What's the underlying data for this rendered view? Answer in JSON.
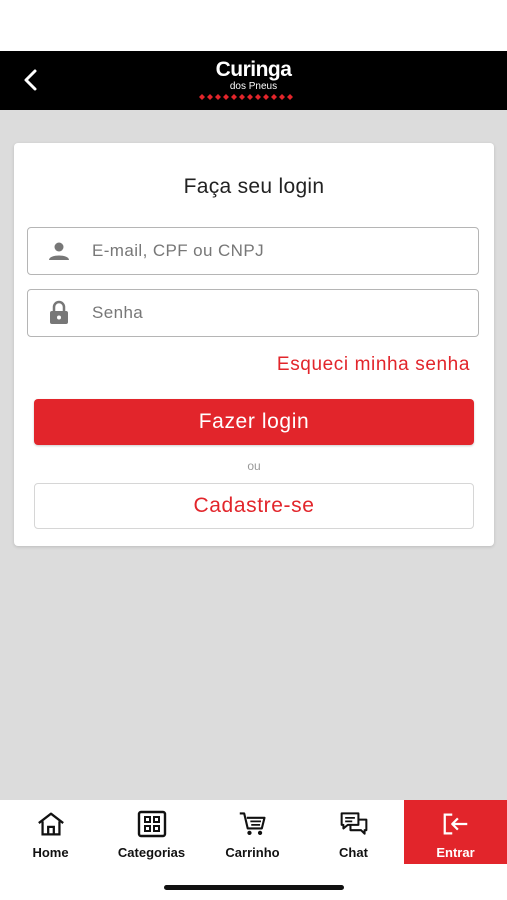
{
  "header": {
    "logo_main": "Curinga",
    "logo_sub": "dos Pneus"
  },
  "login": {
    "title": "Faça seu login",
    "email_placeholder": "E-mail, CPF ou CNPJ",
    "password_placeholder": "Senha",
    "forgot_label": "Esqueci minha senha",
    "login_button": "Fazer login",
    "or_label": "ou",
    "signup_button": "Cadastre-se"
  },
  "tabs": [
    {
      "label": "Home",
      "icon": "home-icon"
    },
    {
      "label": "Categorias",
      "icon": "grid-icon"
    },
    {
      "label": "Carrinho",
      "icon": "cart-icon"
    },
    {
      "label": "Chat",
      "icon": "chat-icon"
    },
    {
      "label": "Entrar",
      "icon": "login-icon"
    }
  ],
  "colors": {
    "accent": "#e2252b",
    "header_bg": "#000000",
    "page_bg": "#dcdcdc"
  }
}
